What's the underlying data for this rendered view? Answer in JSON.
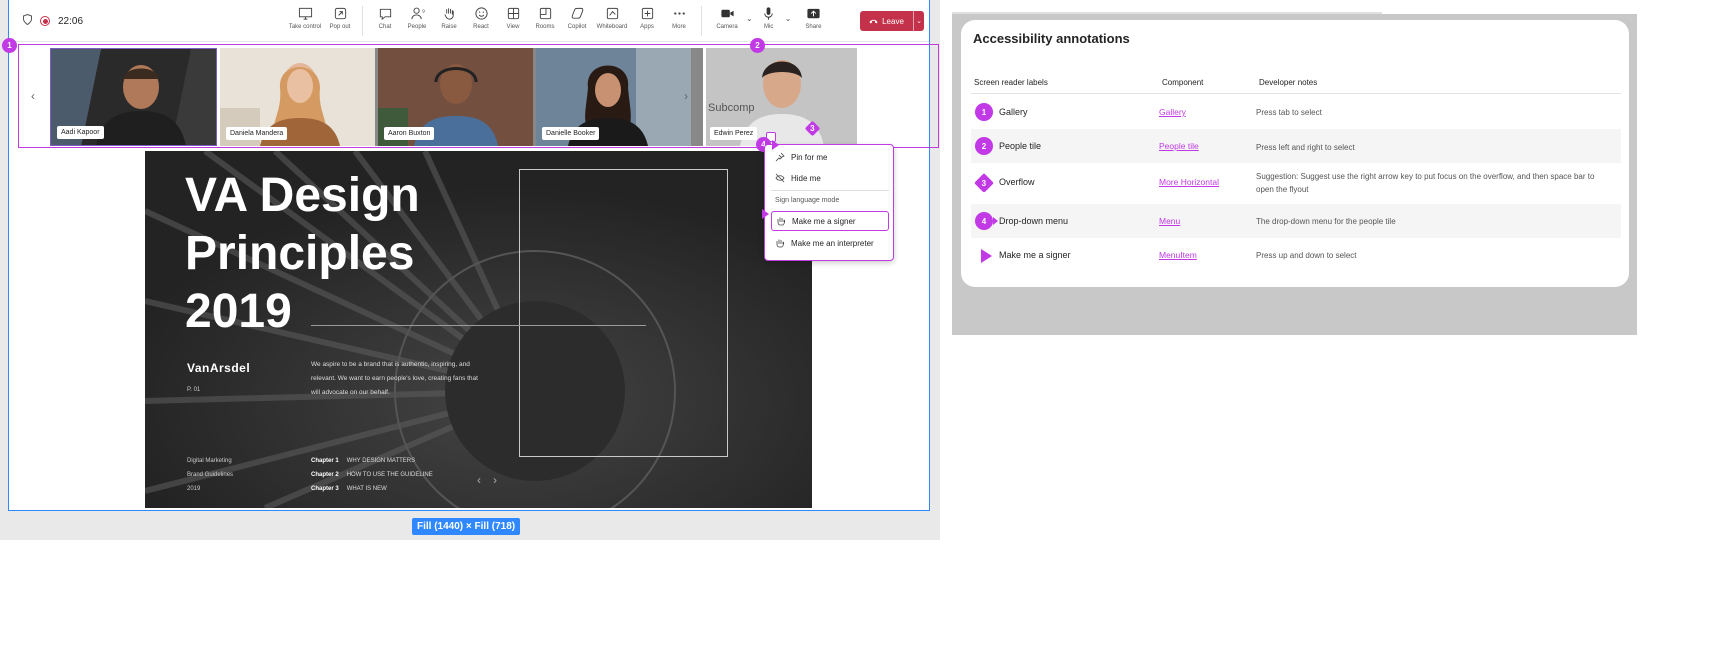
{
  "meeting": {
    "timer": "22:06",
    "toolbar": [
      {
        "id": "take-control",
        "label": "Take control",
        "icon": "take-control-icon"
      },
      {
        "id": "pop-out",
        "label": "Pop out",
        "icon": "pop-out-icon"
      },
      {
        "id": "chat",
        "label": "Chat",
        "icon": "chat-icon"
      },
      {
        "id": "people",
        "label": "People",
        "icon": "people-icon",
        "count": "9"
      },
      {
        "id": "raise",
        "label": "Raise",
        "icon": "raise-hand-icon"
      },
      {
        "id": "react",
        "label": "React",
        "icon": "react-icon"
      },
      {
        "id": "view",
        "label": "View",
        "icon": "view-icon"
      },
      {
        "id": "rooms",
        "label": "Rooms",
        "icon": "rooms-icon"
      },
      {
        "id": "copilot",
        "label": "Copilot",
        "icon": "copilot-icon"
      },
      {
        "id": "whiteboard",
        "label": "Whiteboard",
        "icon": "whiteboard-icon"
      },
      {
        "id": "apps",
        "label": "Apps",
        "icon": "apps-icon"
      },
      {
        "id": "more",
        "label": "More",
        "icon": "more-icon"
      }
    ],
    "camera_label": "Camera",
    "mic_label": "Mic",
    "share_label": "Share",
    "leave_label": "Leave",
    "participants": [
      {
        "name": "Aadi Kapoor"
      },
      {
        "name": "Daniela Mandera"
      },
      {
        "name": "Aaron Buxton"
      },
      {
        "name": "Danielle Booker"
      },
      {
        "name": "Edwin Perez",
        "overlay": "Subcomp"
      }
    ],
    "badges": [
      "1",
      "2",
      "3",
      "4"
    ],
    "flyout": {
      "pin": "Pin for me",
      "hide": "Hide me",
      "section": "Sign language mode",
      "signer": "Make me a signer",
      "interpreter": "Make me an interpreter"
    },
    "slide": {
      "title": "VA Design Principles 2019",
      "brand": "VanArsdel",
      "page": "P. 01",
      "body": "We aspire to be a brand that is authentic, inspiring, and relevant. We want to earn people's love, creating fans that will advocate on our behalf.",
      "footer": [
        "Digital Marketing",
        "Brand Guidelines",
        "2019"
      ],
      "chapters": [
        {
          "num": "Chapter 1",
          "text": "WHY DESIGN MATTERS"
        },
        {
          "num": "Chapter 2",
          "text": "HOW TO USE THE GUIDELINE"
        },
        {
          "num": "Chapter 3",
          "text": "WHAT IS NEW"
        }
      ]
    },
    "fill_chip": "Fill (1440) × Fill (718)"
  },
  "annotations": {
    "title": "Accessibility annotations",
    "headers": {
      "labels": "Screen reader labels",
      "component": "Component",
      "notes": "Developer notes"
    },
    "rows": [
      {
        "marker": "1",
        "label": "Gallery",
        "component": "Gallery",
        "note": "Press tab to select"
      },
      {
        "marker": "2",
        "label": "People tile",
        "component": "People tile",
        "note": "Press left and right to select"
      },
      {
        "marker": "3",
        "label": "Overflow",
        "component": "More Horizontal",
        "note": "Suggestion: Suggest use the right arrow key to put focus on the overflow, and then space bar to open the flyout"
      },
      {
        "marker": "4",
        "label": "Drop-down menu",
        "component": "Menu",
        "note": "The drop-down menu for the people tile"
      },
      {
        "marker": "",
        "label": "Make me a signer",
        "component": "MenuItem",
        "note": "Press up and down to select"
      }
    ]
  },
  "colors": {
    "accent": "#c239e6",
    "leave": "#c4314b",
    "selection": "#2f88ff"
  }
}
